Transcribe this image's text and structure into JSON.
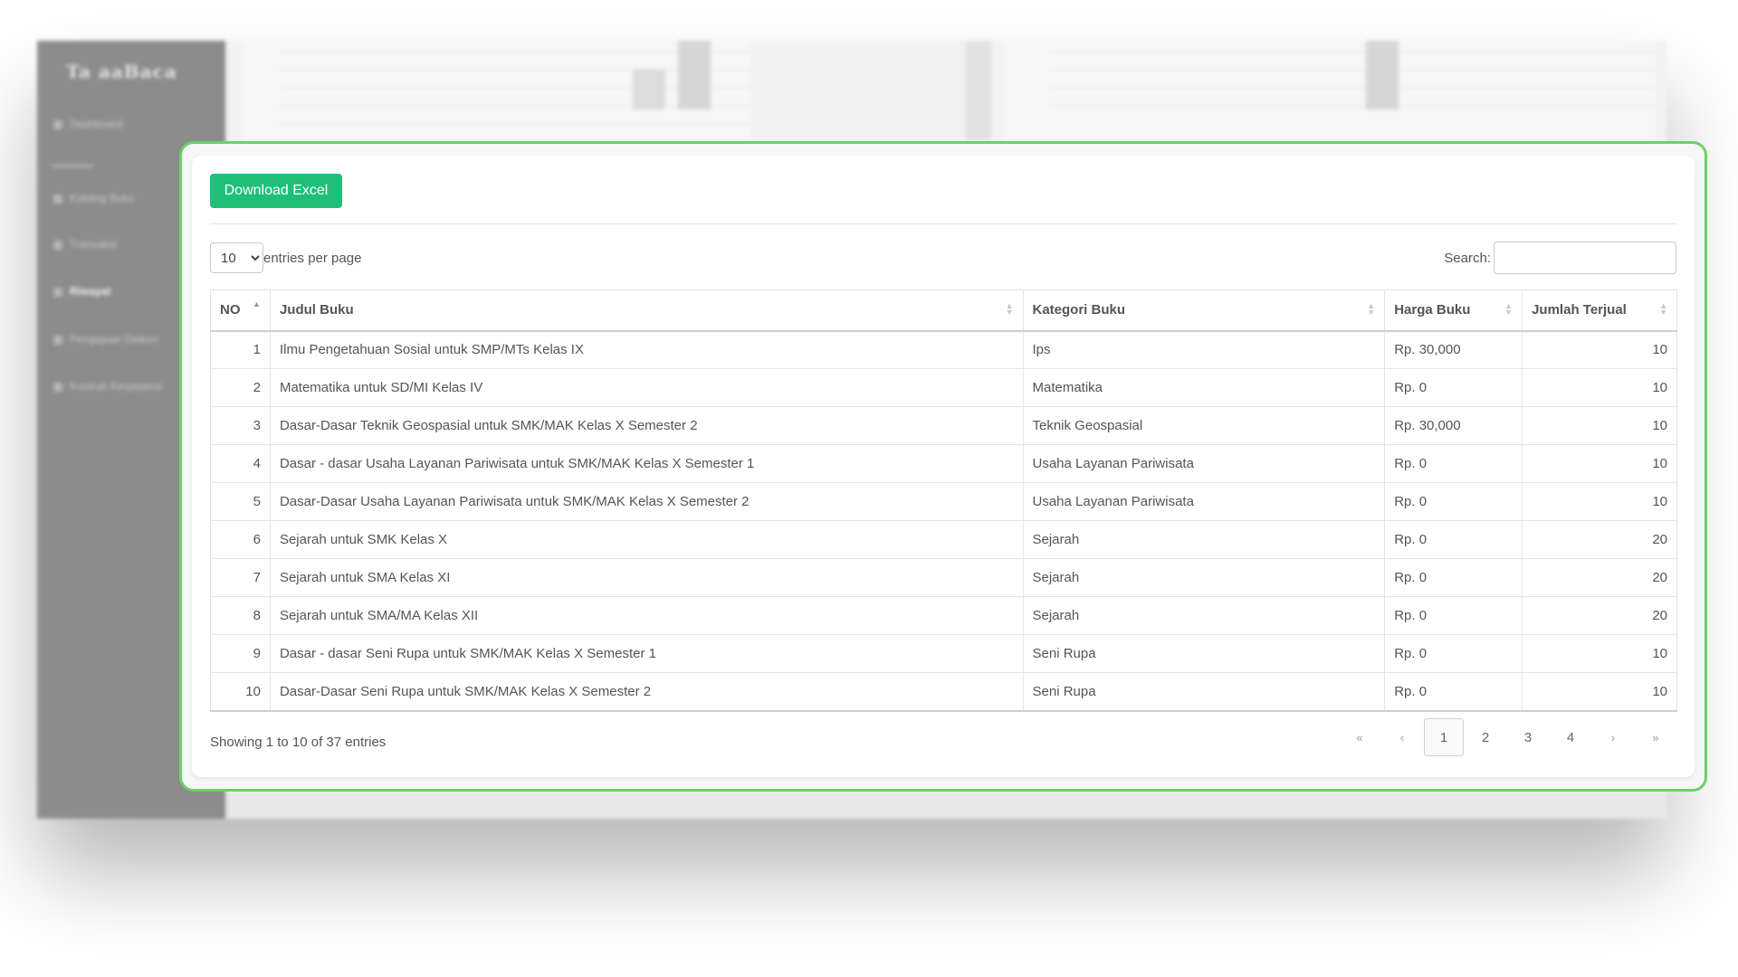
{
  "background": {
    "logo_text": "Ta     aaBaca",
    "nav": [
      {
        "label": "Dashboard",
        "active": false
      },
      {
        "label": "Katalog Buku",
        "active": false
      },
      {
        "label": "Transaksi",
        "active": false
      },
      {
        "label": "Riwayat",
        "active": true
      },
      {
        "label": "Pengajuan Diskon",
        "active": false
      },
      {
        "label": "Kontrak Kerjasama",
        "active": false
      }
    ]
  },
  "toolbar": {
    "download_label": "Download Excel"
  },
  "length": {
    "value": "10",
    "options": [
      "10"
    ],
    "suffix": "entries per page"
  },
  "search": {
    "label": "Search:",
    "value": "",
    "placeholder": ""
  },
  "table": {
    "headers": {
      "no": "NO",
      "title": "Judul Buku",
      "category": "Kategori Buku",
      "price": "Harga Buku",
      "sold": "Jumlah Terjual"
    },
    "rows": [
      {
        "no": "1",
        "title": "Ilmu Pengetahuan Sosial untuk SMP/MTs Kelas IX",
        "category": "Ips",
        "price": "Rp. 30,000",
        "sold": "10"
      },
      {
        "no": "2",
        "title": "Matematika untuk SD/MI Kelas IV",
        "category": "Matematika",
        "price": "Rp. 0",
        "sold": "10"
      },
      {
        "no": "3",
        "title": "Dasar-Dasar Teknik Geospasial untuk SMK/MAK Kelas X Semester 2",
        "category": "Teknik Geospasial",
        "price": "Rp. 30,000",
        "sold": "10"
      },
      {
        "no": "4",
        "title": "Dasar - dasar Usaha Layanan Pariwisata untuk SMK/MAK Kelas X Semester 1",
        "category": "Usaha Layanan Pariwisata",
        "price": "Rp. 0",
        "sold": "10"
      },
      {
        "no": "5",
        "title": "Dasar-Dasar Usaha Layanan Pariwisata untuk SMK/MAK Kelas X Semester 2",
        "category": "Usaha Layanan Pariwisata",
        "price": "Rp. 0",
        "sold": "10"
      },
      {
        "no": "6",
        "title": "Sejarah untuk SMK Kelas X",
        "category": "Sejarah",
        "price": "Rp. 0",
        "sold": "20"
      },
      {
        "no": "7",
        "title": "Sejarah untuk SMA Kelas XI",
        "category": "Sejarah",
        "price": "Rp. 0",
        "sold": "20"
      },
      {
        "no": "8",
        "title": "Sejarah untuk SMA/MA Kelas XII",
        "category": "Sejarah",
        "price": "Rp. 0",
        "sold": "20"
      },
      {
        "no": "9",
        "title": "Dasar - dasar Seni Rupa untuk SMK/MAK Kelas X Semester 1",
        "category": "Seni Rupa",
        "price": "Rp. 0",
        "sold": "10"
      },
      {
        "no": "10",
        "title": "Dasar-Dasar Seni Rupa untuk SMK/MAK Kelas X Semester 2",
        "category": "Seni Rupa",
        "price": "Rp. 0",
        "sold": "10"
      }
    ]
  },
  "info": "Showing 1 to 10 of 37 entries",
  "pagination": {
    "first": "«",
    "prev": "‹",
    "pages": [
      "1",
      "2",
      "3",
      "4"
    ],
    "current": "1",
    "next": "›",
    "last": "»"
  },
  "colors": {
    "accent_green": "#1fbf7a",
    "frame_green": "#6fcf6a",
    "sidebar_gray": "#8c8c8c"
  }
}
